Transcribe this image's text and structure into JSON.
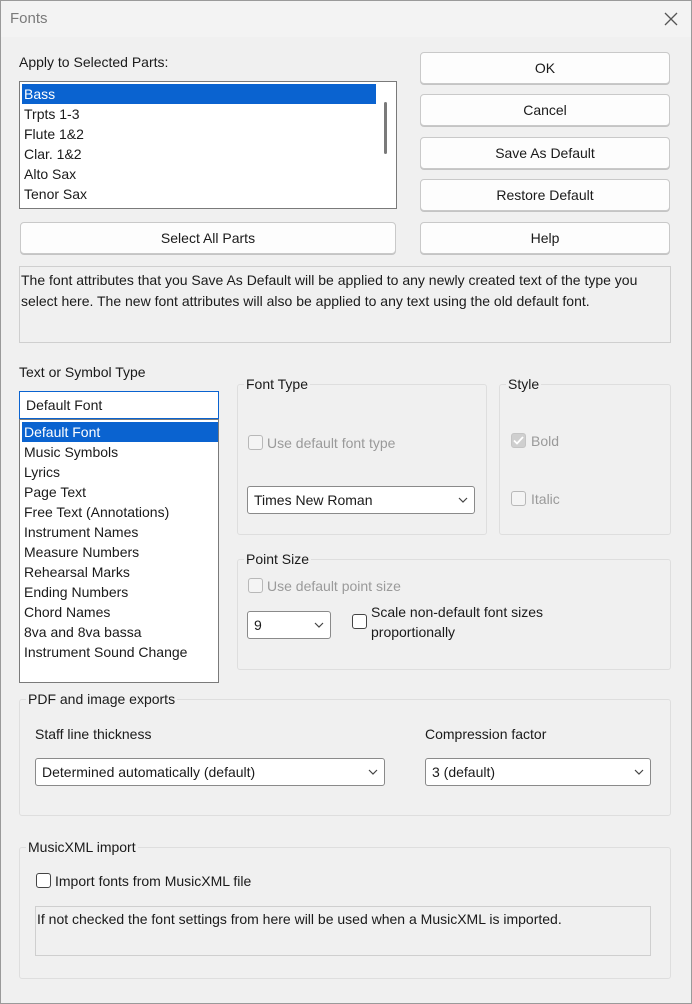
{
  "window": {
    "title": "Fonts"
  },
  "apply_parts": {
    "label": "Apply to Selected Parts:",
    "items": [
      "Bass",
      "Trpts 1-3",
      "Flute 1&2",
      "Clar. 1&2",
      "Alto Sax",
      "Tenor Sax"
    ],
    "select_all_label": "Select All Parts"
  },
  "buttons": {
    "ok": "OK",
    "cancel": "Cancel",
    "save_default": "Save As Default",
    "restore_default": "Restore Default",
    "help": "Help"
  },
  "info_text": "The font attributes that you Save As Default will be applied to any newly created text of the type you select here.   The new font attributes will also be applied to any text using the old default font.",
  "text_type": {
    "label": "Text or Symbol Type",
    "current_value": "Default Font",
    "items": [
      "Default Font",
      "Music Symbols",
      "Lyrics",
      "Page Text",
      "Free Text (Annotations)",
      "Instrument Names",
      "Measure Numbers",
      "Rehearsal Marks",
      "Ending Numbers",
      "Chord Names",
      "8va and 8va bassa",
      "Instrument Sound Change"
    ]
  },
  "font_type": {
    "title": "Font Type",
    "use_default_label": "Use default font type",
    "font_value": "Times New Roman"
  },
  "style": {
    "title": "Style",
    "bold_label": "Bold",
    "bold_checked": true,
    "italic_label": "Italic",
    "italic_checked": false
  },
  "point_size": {
    "title": "Point Size",
    "use_default_label": "Use default point size",
    "size_value": "9",
    "scale_label_line1": "Scale non-default font sizes",
    "scale_label_line2": "proportionally"
  },
  "pdf_exports": {
    "title": "PDF and image exports",
    "staff_label": "Staff line thickness",
    "staff_value": "Determined automatically (default)",
    "compression_label": "Compression factor",
    "compression_value": "3  (default)"
  },
  "musicxml": {
    "title": "MusicXML import",
    "import_label": "Import fonts from MusicXML file",
    "import_checked": false,
    "note": "If not checked the font settings from here will be used when a MusicXML is imported."
  },
  "colors": {
    "selection": "#0a63d0",
    "background": "#f0f0f0",
    "disabled_text": "#9a9a9a"
  }
}
